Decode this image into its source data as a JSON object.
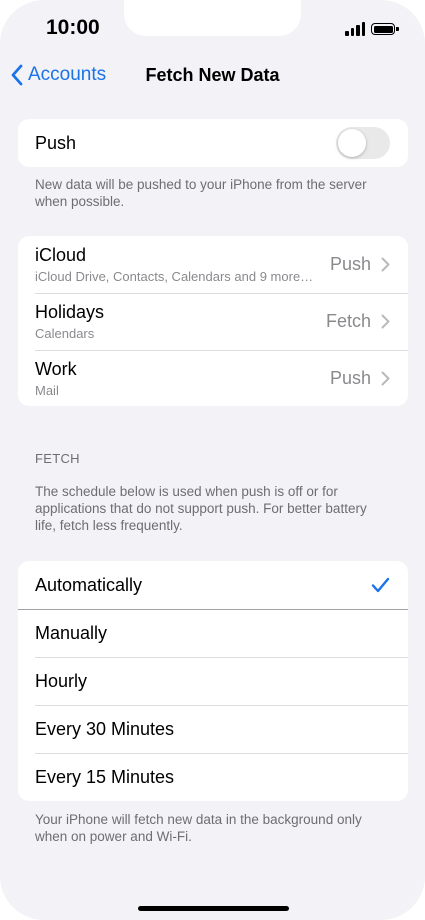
{
  "status_bar": {
    "time": "10:00"
  },
  "nav": {
    "back_label": "Accounts",
    "title": "Fetch New Data"
  },
  "push": {
    "label": "Push",
    "enabled": false,
    "footnote": "New data will be pushed to your iPhone from the server when possible."
  },
  "accounts": [
    {
      "name": "iCloud",
      "detail": "iCloud Drive, Contacts, Calendars and 9 more…",
      "value": "Push"
    },
    {
      "name": "Holidays",
      "detail": "Calendars",
      "value": "Fetch"
    },
    {
      "name": "Work",
      "detail": "Mail",
      "value": "Push"
    }
  ],
  "fetch": {
    "header": "FETCH",
    "description": "The schedule below is used when push is off or for applications that do not support push. For better battery life, fetch less frequently.",
    "options": [
      {
        "label": "Automatically",
        "selected": true
      },
      {
        "label": "Manually",
        "selected": false
      },
      {
        "label": "Hourly",
        "selected": false
      },
      {
        "label": "Every 30 Minutes",
        "selected": false
      },
      {
        "label": "Every 15 Minutes",
        "selected": false
      }
    ],
    "footnote": "Your iPhone will fetch new data in the background only when on power and Wi-Fi."
  },
  "colors": {
    "accent": "#1a73e8",
    "background": "#f2f2f7",
    "secondary_text": "#8a8a8e"
  },
  "icons": [
    "chevron-left-icon",
    "chevron-right-icon",
    "checkmark-icon",
    "signal-icon",
    "battery-icon"
  ]
}
